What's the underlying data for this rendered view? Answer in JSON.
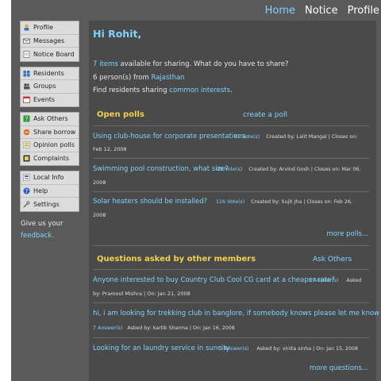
{
  "topnav": {
    "home": "Home",
    "notice": "Notice",
    "profile": "Profile"
  },
  "sidebar": {
    "group1": [
      {
        "label": "Profile",
        "icon": "profile-icon"
      },
      {
        "label": "Messages",
        "icon": "envelope-icon"
      },
      {
        "label": "Notice Board",
        "icon": "notice-board-icon"
      }
    ],
    "group2": [
      {
        "label": "Residents",
        "icon": "residents-icon"
      },
      {
        "label": "Groups",
        "icon": "groups-icon"
      },
      {
        "label": "Events",
        "icon": "calendar-icon"
      }
    ],
    "group3": [
      {
        "label": "Ask Others",
        "icon": "ask-others-icon"
      },
      {
        "label": "Share borrow",
        "icon": "share-borrow-icon"
      },
      {
        "label": "Opinion polls",
        "icon": "opinion-polls-icon"
      },
      {
        "label": "Complaints",
        "icon": "complaints-icon"
      }
    ],
    "group4": [
      {
        "label": "Local Info",
        "icon": "local-info-icon"
      },
      {
        "label": "Help",
        "icon": "help-icon"
      },
      {
        "label": "Settings",
        "icon": "settings-icon"
      }
    ],
    "feedback_prefix": "Give us your",
    "feedback_link": "feedback."
  },
  "main": {
    "greeting": "Hi Rohit,",
    "items_link": "7 items",
    "items_rest": " available for sharing. What do you have to share?",
    "persons_prefix": "6 person(s) from ",
    "persons_place": "Rajasthan",
    "residents_prefix": "Find residents sharing ",
    "residents_link": "common interests",
    "residents_suffix": ".",
    "polls": {
      "title": "Open polls",
      "action": "create a poll",
      "items": [
        {
          "question": "Using club-house for corporate presentations.",
          "votes": "91 Vote(s)",
          "created_by": "Created by: Lalit Mangal | Closes on:",
          "date": "Feb 12, 2008"
        },
        {
          "question": "Swimming pool construction, what size?",
          "votes": "98 Vote(s)",
          "created_by": "Created by: Arvind Gosh | Closes on: Mar 06,",
          "date": "2008"
        },
        {
          "question": "Solar heaters should be installed?",
          "votes": "116 Vote(s)",
          "created_by": "Created by: Sujit Jha | Closes on: Feb 26,",
          "date": "2008"
        }
      ],
      "more": "more polls..."
    },
    "questions": {
      "title": "Questions asked by other members",
      "action": "Ask Others",
      "items": [
        {
          "question": "Anyone interested to buy Country Club Cool CG card at a cheaper rate?",
          "answers": "5 Answer(s)",
          "asked_tail": "Asked",
          "sub": "by: Pramool Mishra | On: Jan 21, 2008"
        },
        {
          "question": "hi, i am looking for trekking club in banglore, if somebody knows please let me know ! thanks..",
          "answers": "7 Answer(s)",
          "sub": "Asked by: kartik Sharma | On: Jan 16, 2008"
        },
        {
          "question": "Looking for an laundry service in suncity",
          "answers": "5 Answer(s)",
          "sub": "Asked by: vinita sinha | On: Jan 15, 2008"
        }
      ],
      "more": "more questions..."
    }
  },
  "colors": {
    "frame_bg": "#5a5a5a",
    "main_bg": "#4a4a4a",
    "link": "#7fd3ff",
    "section_title": "#f2d04a",
    "sidebar_bg": "#dcdcdc"
  }
}
